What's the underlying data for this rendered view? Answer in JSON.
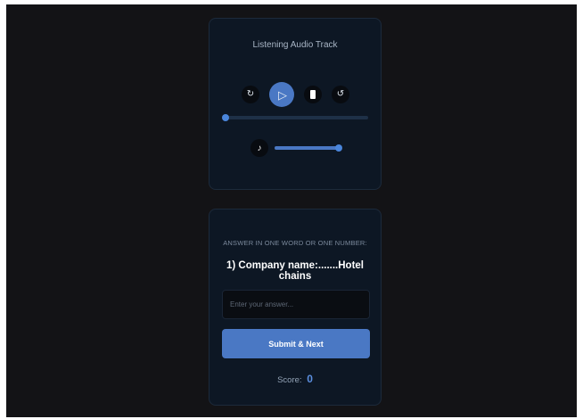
{
  "player": {
    "title": "Listening Audio Track",
    "progress": 0,
    "volume": 1,
    "icons": {
      "rewind": "rewind-icon",
      "play": "play-icon",
      "stop": "stop-icon",
      "forward": "forward-icon",
      "volume": "music-note-icon"
    },
    "glyphs": {
      "rewind": "↻",
      "play": "▷",
      "forward": "↺",
      "note": "♪"
    }
  },
  "quiz": {
    "instruction": "ANSWER IN ONE WORD OR ONE NUMBER:",
    "question": "1) Company name:.......Hotel chains",
    "input_placeholder": "Enter your answer...",
    "input_value": "",
    "submit_label": "Submit & Next",
    "score_label": "Score:",
    "score_value": "0"
  },
  "colors": {
    "page_bg": "#131316",
    "card_bg": "#0d1724",
    "accent": "#4a78c4",
    "knob": "#4a86dc",
    "track": "#1e3047"
  }
}
